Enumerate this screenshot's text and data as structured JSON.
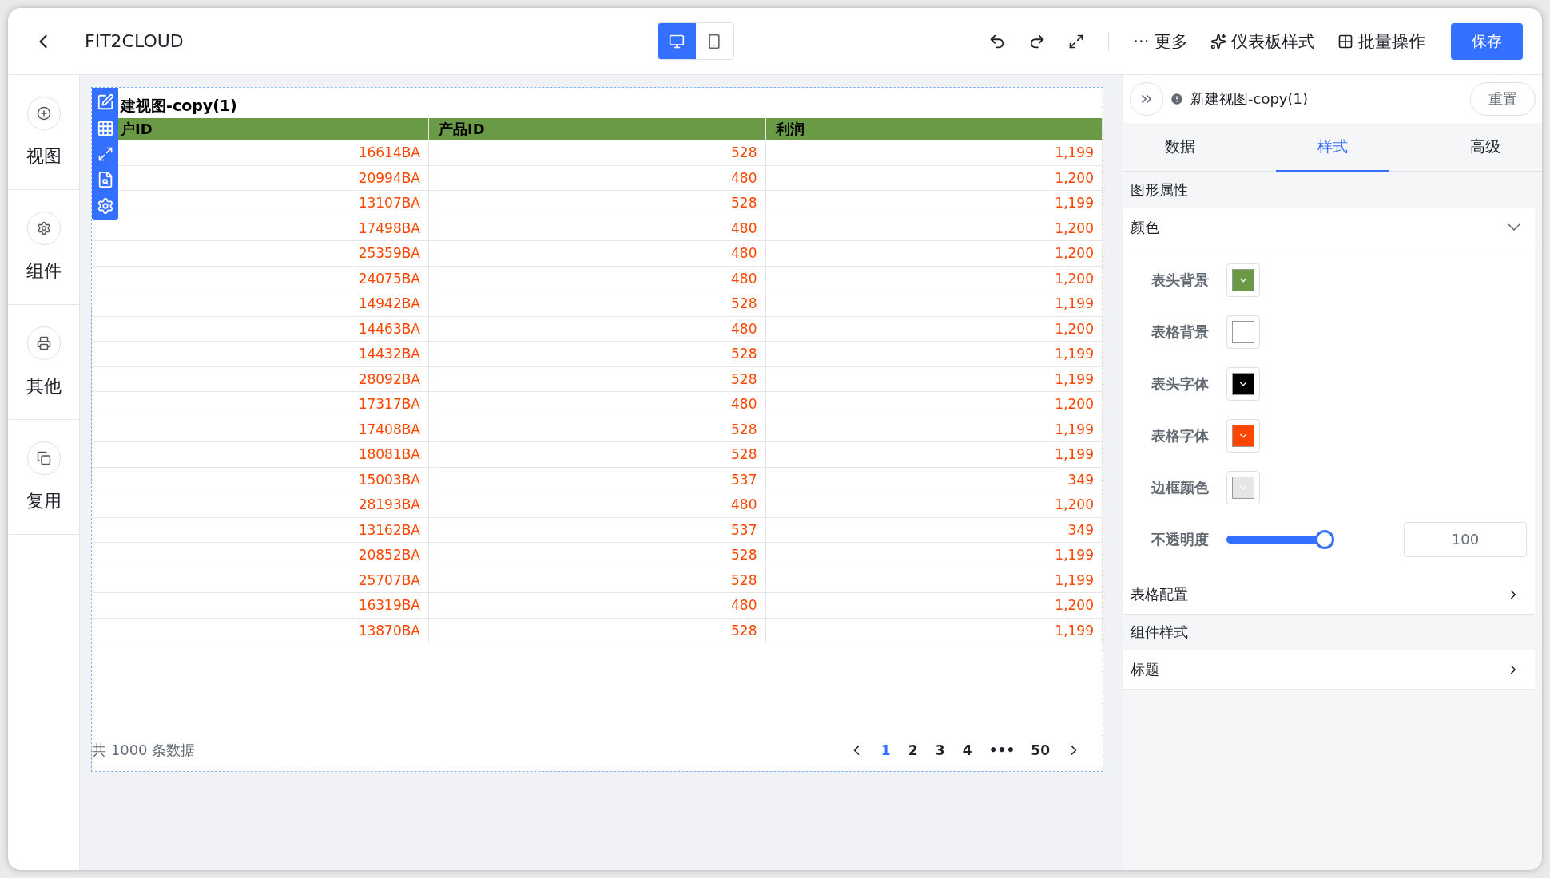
{
  "topbar": {
    "title": "FIT2CLOUD",
    "devices": [
      {
        "kind": "desktop",
        "selected": true
      },
      {
        "kind": "mobile",
        "selected": false
      }
    ],
    "more": "··· 更多",
    "style_button": "仪表板样式",
    "batch_button": "批量操作",
    "save_button": "保存"
  },
  "sidebar": {
    "items": [
      {
        "kind": "view",
        "label": "视图"
      },
      {
        "kind": "component",
        "label": "组件"
      },
      {
        "kind": "other",
        "label": "其他"
      },
      {
        "kind": "reuse",
        "label": "复用"
      }
    ]
  },
  "widget": {
    "title": "建视图-copy(1)",
    "columns": [
      "户ID",
      "产品ID",
      "利润"
    ],
    "rows": [
      [
        "16614BA",
        "528",
        "1,199"
      ],
      [
        "20994BA",
        "480",
        "1,200"
      ],
      [
        "13107BA",
        "528",
        "1,199"
      ],
      [
        "17498BA",
        "480",
        "1,200"
      ],
      [
        "25359BA",
        "480",
        "1,200"
      ],
      [
        "24075BA",
        "480",
        "1,200"
      ],
      [
        "14942BA",
        "528",
        "1,199"
      ],
      [
        "14463BA",
        "480",
        "1,200"
      ],
      [
        "14432BA",
        "528",
        "1,199"
      ],
      [
        "28092BA",
        "528",
        "1,199"
      ],
      [
        "17317BA",
        "480",
        "1,200"
      ],
      [
        "17408BA",
        "528",
        "1,199"
      ],
      [
        "18081BA",
        "528",
        "1,199"
      ],
      [
        "15003BA",
        "537",
        "349"
      ],
      [
        "28193BA",
        "480",
        "1,200"
      ],
      [
        "13162BA",
        "537",
        "349"
      ],
      [
        "20852BA",
        "528",
        "1,199"
      ],
      [
        "25707BA",
        "528",
        "1,199"
      ],
      [
        "16319BA",
        "480",
        "1,200"
      ],
      [
        "13870BA",
        "528",
        "1,199"
      ]
    ],
    "total": "共 1000 条数据",
    "pages": [
      {
        "label": "1",
        "selected": true
      },
      {
        "label": "2",
        "selected": false
      },
      {
        "label": "3",
        "selected": false
      },
      {
        "label": "4",
        "selected": false
      },
      {
        "label": "•••",
        "selected": false
      },
      {
        "label": "50",
        "selected": false
      }
    ]
  },
  "panel": {
    "view_name": "新建视图-copy(1)",
    "reset": "重置",
    "tabs": [
      {
        "label": "数据",
        "selected": false
      },
      {
        "label": "样式",
        "selected": true
      },
      {
        "label": "高级",
        "selected": false
      }
    ],
    "section": "图形属性",
    "color_group": {
      "label": "颜色",
      "expanded": true,
      "colors": [
        {
          "label": "表头背景",
          "color": "#6b9a47"
        },
        {
          "label": "表格背景",
          "color": "#ffffff"
        },
        {
          "label": "表头字体",
          "color": "#000000"
        },
        {
          "label": "表格字体",
          "color": "#ff4500"
        },
        {
          "label": "边框颜色",
          "color": "#e6e6e6"
        }
      ],
      "opacity": {
        "label": "不透明度",
        "level": 1,
        "value": "100"
      }
    },
    "table_config": {
      "label": "表格配置",
      "expanded": false
    },
    "section2": "组件样式",
    "title_config": {
      "label": "标题",
      "expanded": false
    }
  }
}
